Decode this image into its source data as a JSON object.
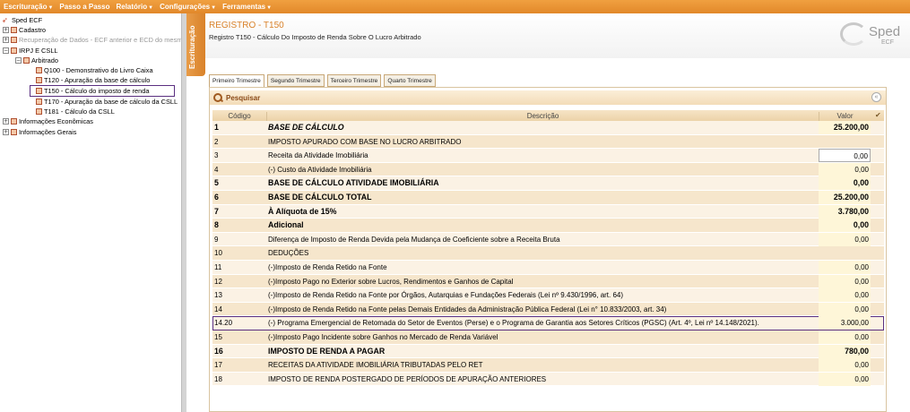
{
  "menu": [
    {
      "label": "Escrituração",
      "caret": true
    },
    {
      "label": "Passo a Passo",
      "caret": false
    },
    {
      "label": "Relatório",
      "caret": true
    },
    {
      "label": "Configurações",
      "caret": true
    },
    {
      "label": "Ferramentas",
      "caret": true
    }
  ],
  "tree": {
    "root": "Sped ECF",
    "cadastro": "Cadastro",
    "recuperacao": "Recuperação de Dados - ECF anterior e ECD do mesmo",
    "irpj": "IRPJ E CSLL",
    "arbitrado": "Arbitrado",
    "q100": "Q100 - Demonstrativo do Livro Caixa",
    "t120": "T120 - Apuração da base de cálculo",
    "t150": "T150 - Cálculo do imposto de renda",
    "t170": "T170 - Apuração da base de cálculo da CSLL",
    "t181": "T181 - Cálculo da CSLL",
    "info_econ": "Informações Econômicas",
    "info_gerais": "Informações Gerais"
  },
  "vertical_tab": "Escrituração",
  "header": {
    "title": "REGISTRO - T150",
    "subtitle": "Registro T150 - Cálculo Do Imposto de Renda Sobre O Lucro Arbitrado"
  },
  "logo": {
    "word": "Sped",
    "sub": "ECF"
  },
  "tabs": [
    "Primeiro Trimestre",
    "Segundo Trimestre",
    "Terceiro Trimestre",
    "Quarto Trimestre"
  ],
  "search": {
    "label": "Pesquisar"
  },
  "table": {
    "headers": {
      "code": "Código",
      "desc": "Descrição",
      "value": "Valor",
      "check": "✔"
    },
    "rows": [
      {
        "code": "1",
        "desc": "BASE DE CÁLCULO",
        "value": "25.200,00"
      },
      {
        "code": "2",
        "desc": "IMPOSTO APURADO COM BASE NO LUCRO ARBITRADO",
        "value": ""
      },
      {
        "code": "3",
        "desc": "Receita da Atividade Imobiliária",
        "value": "0,00"
      },
      {
        "code": "4",
        "desc": "(-) Custo da Atividade Imobiliária",
        "value": "0,00"
      },
      {
        "code": "5",
        "desc": "BASE DE CÁLCULO  ATIVIDADE IMOBILIÁRIA",
        "value": "0,00"
      },
      {
        "code": "6",
        "desc": "BASE DE CÁLCULO TOTAL",
        "value": "25.200,00"
      },
      {
        "code": "7",
        "desc": "À Alíquota de 15%",
        "value": "3.780,00"
      },
      {
        "code": "8",
        "desc": "Adicional",
        "value": "0,00"
      },
      {
        "code": "9",
        "desc": "Diferença de Imposto de Renda Devida pela Mudança de Coeficiente sobre a Receita Bruta",
        "value": "0,00"
      },
      {
        "code": "10",
        "desc": "DEDUÇÕES",
        "value": ""
      },
      {
        "code": "11",
        "desc": "(-)Imposto de Renda Retido na Fonte",
        "value": "0,00"
      },
      {
        "code": "12",
        "desc": "(-)Imposto Pago no Exterior sobre Lucros, Rendimentos e Ganhos de Capital",
        "value": "0,00"
      },
      {
        "code": "13",
        "desc": "(-)Imposto de Renda Retido na Fonte por Órgãos, Autarquias e Fundações Federais (Lei nº 9.430/1996, art. 64)",
        "value": "0,00"
      },
      {
        "code": "14",
        "desc": "(-)Imposto de Renda Retido na Fonte pelas Demais Entidades da Administração Pública Federal (Lei n° 10.833/2003, art. 34)",
        "value": "0,00"
      },
      {
        "code": "14.20",
        "desc": "(-) Programa Emergencial de Retomada do Setor de Eventos (Perse) e o Programa de Garantia aos Setores Críticos (PGSC) (Art. 4º, Lei nº 14.148/2021).",
        "value": "3.000,00"
      },
      {
        "code": "15",
        "desc": "(-)Imposto Pago Incidente sobre Ganhos no Mercado de Renda Variável",
        "value": "0,00"
      },
      {
        "code": "16",
        "desc": "IMPOSTO DE RENDA A PAGAR",
        "value": "780,00"
      },
      {
        "code": "17",
        "desc": "RECEITAS DA ATIVIDADE IMOBILIÁRIA TRIBUTADAS PELO RET",
        "value": "0,00"
      },
      {
        "code": "18",
        "desc": "IMPOSTO DE RENDA POSTERGADO DE PERÍODOS DE APURAÇÃO ANTERIORES",
        "value": "0,00"
      }
    ]
  }
}
